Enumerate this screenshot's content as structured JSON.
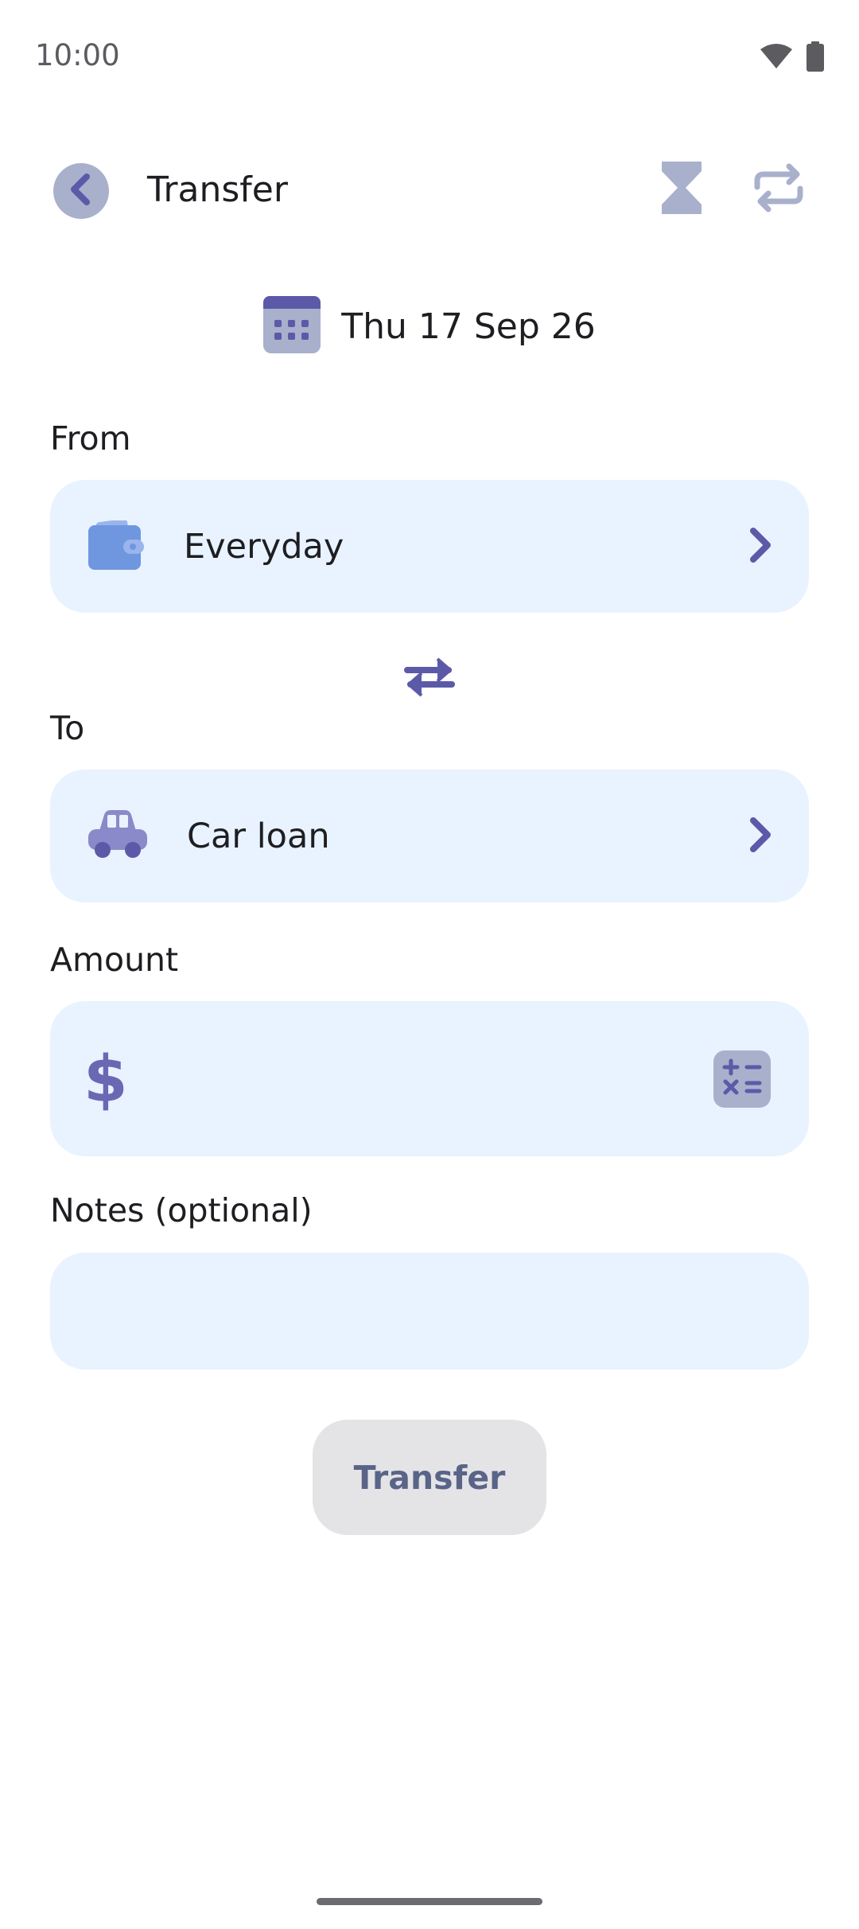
{
  "status_bar": {
    "time": "10:00",
    "wifi_icon": "wifi-icon",
    "battery_icon": "battery-icon"
  },
  "header": {
    "title": "Transfer",
    "back_icon": "chevron-left-icon",
    "actions": [
      "hourglass-icon",
      "repeat-icon"
    ]
  },
  "date": {
    "icon": "calendar-icon",
    "text": "Thu 17 Sep 26"
  },
  "from": {
    "label": "From",
    "account": "Everyday",
    "icon": "wallet-icon"
  },
  "swap": {
    "icon": "swap-arrows-icon"
  },
  "to": {
    "label": "To",
    "account": "Car loan",
    "icon": "car-icon"
  },
  "amount": {
    "label": "Amount",
    "currency_symbol": "$",
    "value": "",
    "calculator_icon": "calculator-icon"
  },
  "notes": {
    "label": "Notes (optional)",
    "value": ""
  },
  "submit": {
    "label": "Transfer"
  },
  "colors": {
    "accent": "#6a68b3",
    "card_bg": "#e8f3ff",
    "icon_muted": "#a9b0cc",
    "button_disabled_bg": "#e4e4e6"
  }
}
